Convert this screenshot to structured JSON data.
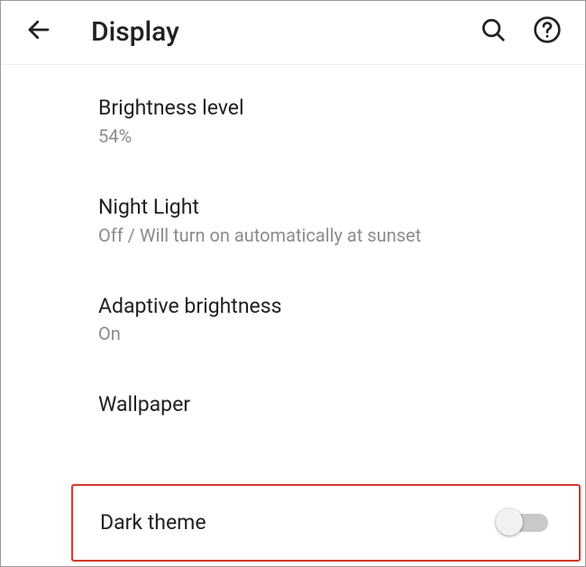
{
  "header": {
    "title": "Display"
  },
  "items": {
    "brightness": {
      "title": "Brightness level",
      "value": "54%"
    },
    "nightlight": {
      "title": "Night Light",
      "value": "Off / Will turn on automatically at sunset"
    },
    "adaptive": {
      "title": "Adaptive brightness",
      "value": "On"
    },
    "wallpaper": {
      "title": "Wallpaper"
    },
    "darktheme": {
      "title": "Dark theme",
      "state": "off"
    }
  }
}
